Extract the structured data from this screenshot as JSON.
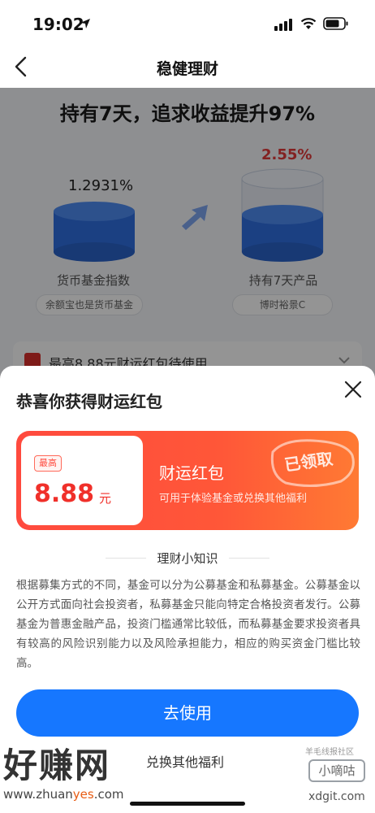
{
  "status_bar": {
    "time": "19:02"
  },
  "nav": {
    "title": "稳健理财",
    "back_icon": "chevron-left-icon"
  },
  "background": {
    "headline_prefix": "持有7天，追求",
    "headline_emphasis": "收益",
    "headline_suffix": "提升97%",
    "left_rate": "1.2931%",
    "right_rate": "2.55%",
    "left_label": "货币基金指数",
    "right_label": "持有7天产品",
    "left_pill": "余额宝也是货币基金",
    "right_pill": "博时裕景C",
    "coupon_strip_text": "最高8.88元财运红包待使用"
  },
  "sheet": {
    "title": "恭喜你获得财运红包",
    "card": {
      "max_tag": "最高",
      "amount": "8.88",
      "unit": "元",
      "name": "财运红包",
      "description": "可用于体验基金或兑换其他福利",
      "stamp": "已领取"
    },
    "tips_title": "理财小知识",
    "tips_body": "根据募集方式的不同，基金可以分为公募基金和私募基金。公募基金以公开方式面向社会投资者，私募基金只能向特定合格投资者发行。公募基金为普惠金融产品，投资门槛通常比较低，而私募基金要求投资者具有较高的风险识别能力以及风险承担能力，相应的购买资金门槛比较高。",
    "cta_label": "去使用",
    "exchange_link": "兑换其他福利"
  },
  "watermarks": {
    "left_big": "好赚网",
    "left_url_a": "www.zhuan",
    "left_url_b": "yes",
    "left_url_c": ".com",
    "right_small": "羊毛线报社区",
    "right_box": "小嘀咕",
    "right_domain": "xdgit.com"
  },
  "colors": {
    "accent": "#1677ff",
    "card_red": "#ff4a3e",
    "rate_red": "#e23a3a"
  }
}
